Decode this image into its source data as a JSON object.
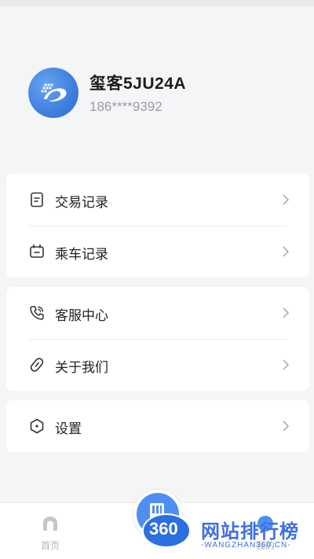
{
  "profile": {
    "name": "玺客5JU24A",
    "phone": "186****9392"
  },
  "menu": {
    "group1": [
      {
        "label": "交易记录",
        "icon": "receipt-icon"
      },
      {
        "label": "乘车记录",
        "icon": "bus-ticket-icon"
      }
    ],
    "group2": [
      {
        "label": "客服中心",
        "icon": "phone-icon"
      },
      {
        "label": "关于我们",
        "icon": "link-icon"
      }
    ],
    "group3": [
      {
        "label": "设置",
        "icon": "hexagon-settings-icon"
      }
    ]
  },
  "tabbar": {
    "home_label": "首页",
    "mine_label": "我的"
  },
  "watermark": {
    "badge": "360",
    "title": "网站排行榜",
    "subtitle": "-WANGZHAN360.CN-"
  },
  "colors": {
    "accent": "#4e8ef2",
    "background": "#f4f5f7",
    "watermark": "#3f6fe0"
  }
}
